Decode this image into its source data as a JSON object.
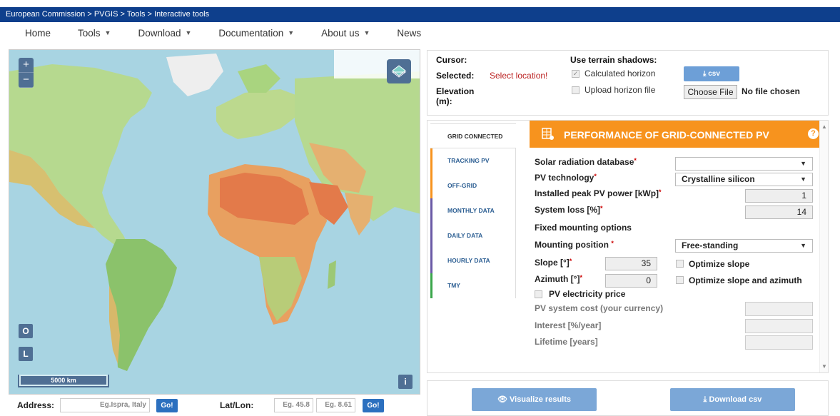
{
  "breadcrumb": [
    "European Commission",
    "PVGIS",
    "Tools",
    "Interactive tools"
  ],
  "breadcrumb_sep": " > ",
  "nav": {
    "home": "Home",
    "tools": "Tools",
    "download": "Download",
    "documentation": "Documentation",
    "about": "About us",
    "news": "News"
  },
  "map": {
    "zoom_in": "+",
    "zoom_out": "−",
    "btn_o": "O",
    "btn_l": "L",
    "btn_i": "i",
    "scale": "5000 km"
  },
  "address": {
    "label": "Address:",
    "placeholder": "Eg.Ispra, Italy",
    "go": "Go!",
    "latlon_label": "Lat/Lon:",
    "lat_placeholder": "Eg. 45.8",
    "lon_placeholder": "Eg. 8.61",
    "go2": "Go!"
  },
  "info": {
    "cursor": "Cursor:",
    "selected": "Selected:",
    "select_location": "Select location!",
    "elevation": "Elevation",
    "elevation_unit": "(m):",
    "terrain": "Use terrain shadows:",
    "calc_horizon": "Calculated horizon",
    "upload_horizon": "Upload horizon file",
    "csv": "csv",
    "choose_file": "Choose File",
    "no_file": "No file chosen"
  },
  "tabs": [
    {
      "label": "GRID CONNECTED",
      "color": "#ffffff"
    },
    {
      "label": "TRACKING PV",
      "color": "#f7931e"
    },
    {
      "label": "OFF-GRID",
      "color": "#f7931e"
    },
    {
      "label": "MONTHLY DATA",
      "color": "#6a5aa6"
    },
    {
      "label": "DAILY DATA",
      "color": "#6a5aa6"
    },
    {
      "label": "HOURLY DATA",
      "color": "#6a5aa6"
    },
    {
      "label": "TMY",
      "color": "#3aa64b"
    }
  ],
  "form": {
    "title": "PERFORMANCE OF GRID-CONNECTED PV",
    "help": "?",
    "solar_db": "Solar radiation database",
    "solar_db_value": "",
    "pv_tech": "PV technology",
    "pv_tech_value": "Crystalline silicon",
    "peak_power": "Installed peak PV power [kWp]",
    "peak_power_value": "1",
    "system_loss": "System loss [%]",
    "system_loss_value": "14",
    "fixed_mount": "Fixed mounting options",
    "mount_pos": "Mounting position",
    "mount_pos_value": "Free-standing",
    "slope": "Slope [°]",
    "slope_value": "35",
    "azimuth": "Azimuth [°]",
    "azimuth_value": "0",
    "opt_slope": "Optimize slope",
    "opt_slope_az": "Optimize slope and azimuth",
    "price": "PV electricity price",
    "cost": "PV system cost (your currency)",
    "interest": "Interest [%/year]",
    "lifetime": "Lifetime [years]",
    "req": "*"
  },
  "buttons": {
    "visualize": "Visualize results",
    "download_csv": "Download csv"
  },
  "colors": {
    "header_blue": "#0e3f8c",
    "accent_orange": "#f7931e",
    "button_blue": "#7ba7d7"
  }
}
